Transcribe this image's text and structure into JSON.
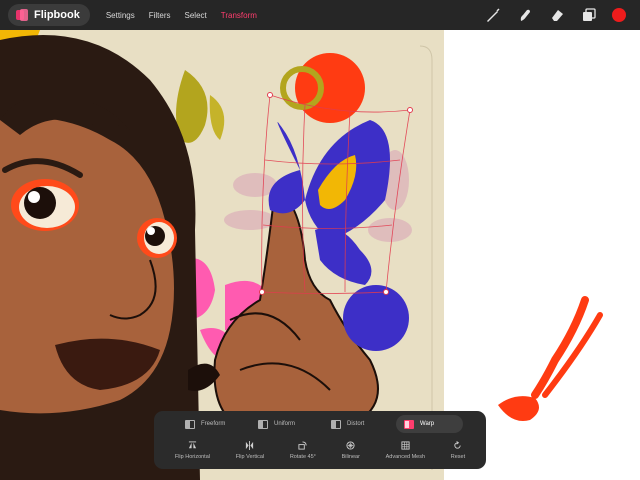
{
  "app": {
    "name": "Flipbook",
    "logo_color": "#e8336b"
  },
  "menu": {
    "settings": "Settings",
    "filters": "Filters",
    "select": "Select",
    "transform": "Transform",
    "active": "Transform",
    "active_color": "#ff3d6e"
  },
  "tools": [
    {
      "name": "brush-icon"
    },
    {
      "name": "smudge-icon"
    },
    {
      "name": "eraser-icon"
    },
    {
      "name": "layers-icon"
    },
    {
      "name": "color-swatch",
      "color": "#ee1c1c"
    }
  ],
  "transform_panel": {
    "modes": [
      {
        "label": "Freeform",
        "icon": "freeform-icon",
        "active": false
      },
      {
        "label": "Uniform",
        "icon": "uniform-icon",
        "active": false
      },
      {
        "label": "Distort",
        "icon": "distort-icon",
        "active": false
      },
      {
        "label": "Warp",
        "icon": "warp-icon",
        "active": true
      }
    ],
    "actions": [
      {
        "label": "Flip Horizontal",
        "icon": "flip-horizontal-icon"
      },
      {
        "label": "Flip Vertical",
        "icon": "flip-vertical-icon"
      },
      {
        "label": "Rotate 45°",
        "icon": "rotate-icon"
      },
      {
        "label": "Bilinear",
        "icon": "bilinear-icon"
      },
      {
        "label": "Advanced Mesh",
        "icon": "mesh-icon"
      },
      {
        "label": "Reset",
        "icon": "reset-icon"
      }
    ]
  },
  "colors": {
    "toolbar_bg": "#262626",
    "panel_bg": "#2b2b2b",
    "paper": "#e8dfc4",
    "skin": "#a8623c",
    "hair": "#2a1a12",
    "butterfly_blue": "#3d2fc7",
    "butterfly_yellow": "#f2b705",
    "sun_red": "#ff3b12",
    "accent_pink": "#ff5bb0",
    "warp_grid": "#e23b4e"
  }
}
